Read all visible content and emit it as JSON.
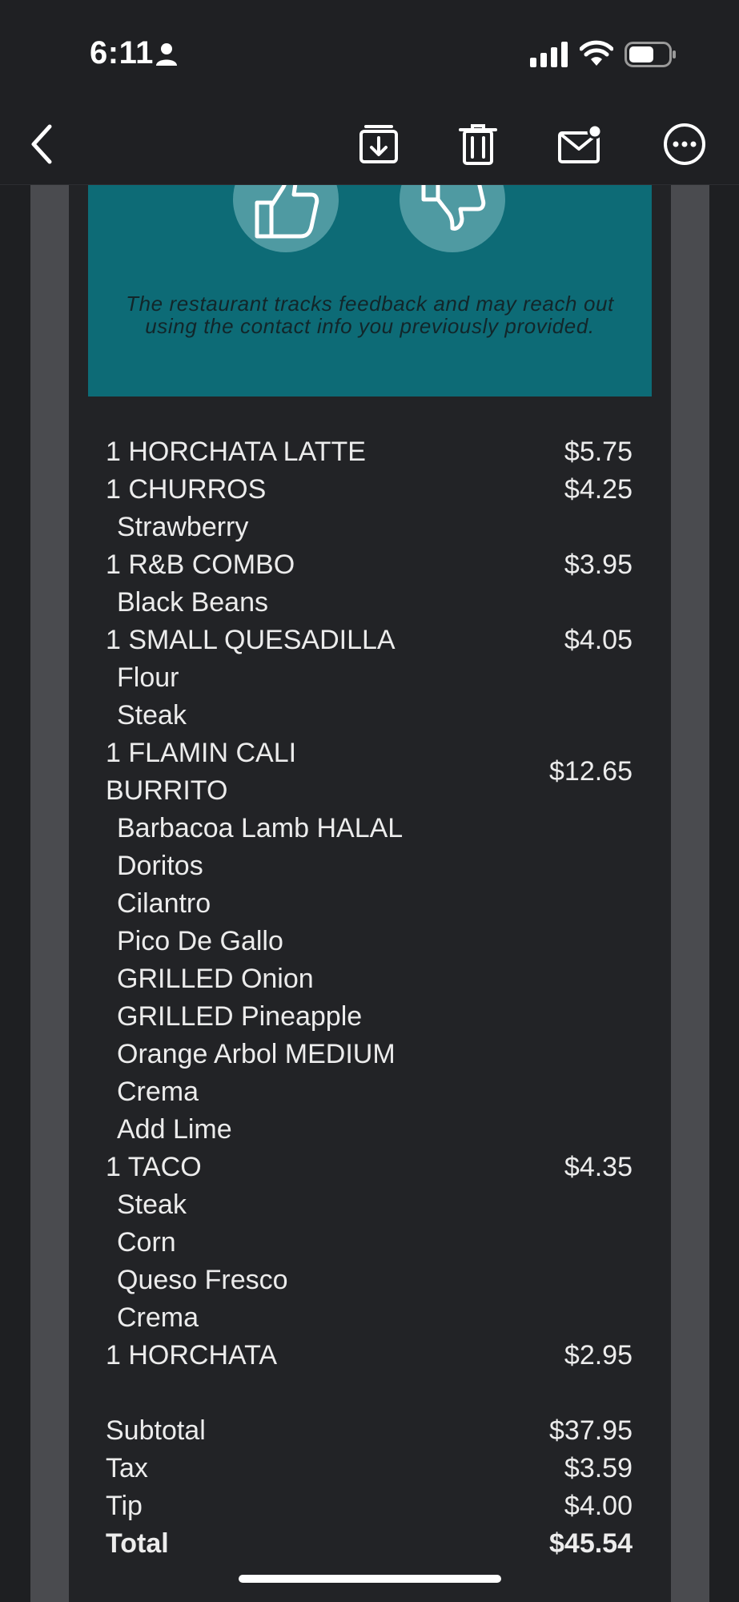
{
  "status_bar": {
    "time": "6:11"
  },
  "feedback": {
    "note": "The restaurant tracks feedback and may reach out using the contact info you previously provided."
  },
  "items": [
    {
      "name": "1 HORCHATA LATTE",
      "price": "$5.75",
      "mods": []
    },
    {
      "name": "1 CHURROS",
      "price": "$4.25",
      "mods": [
        "Strawberry"
      ]
    },
    {
      "name": "1 R&B COMBO",
      "price": "$3.95",
      "mods": [
        "Black Beans"
      ]
    },
    {
      "name": "1 SMALL QUESADILLA",
      "price": "$4.05",
      "mods": [
        "Flour",
        "Steak"
      ]
    },
    {
      "name": "1 FLAMIN CALI BURRITO",
      "price": "$12.65",
      "mods": [
        "Barbacoa Lamb HALAL",
        "Doritos",
        "Cilantro",
        "Pico De Gallo",
        "GRILLED Onion",
        "GRILLED Pineapple",
        "Orange Arbol MEDIUM",
        "Crema",
        "Add Lime"
      ]
    },
    {
      "name": "1 TACO",
      "price": "$4.35",
      "mods": [
        "Steak",
        "Corn",
        "Queso Fresco",
        "Crema"
      ]
    },
    {
      "name": "1 HORCHATA",
      "price": "$2.95",
      "mods": []
    }
  ],
  "summary": {
    "subtotal_label": "Subtotal",
    "subtotal": "$37.95",
    "tax_label": "Tax",
    "tax": "$3.59",
    "tip_label": "Tip",
    "tip": "$4.00",
    "total_label": "Total",
    "total": "$45.54"
  },
  "icons": {
    "back": "chevron-left-icon",
    "archive": "archive-download-icon",
    "trash": "trash-icon",
    "mail": "mail-unread-icon",
    "more": "more-ellipsis-icon"
  },
  "colors": {
    "feedback_bg": "#0d6b76",
    "background": "#1e1f22"
  }
}
